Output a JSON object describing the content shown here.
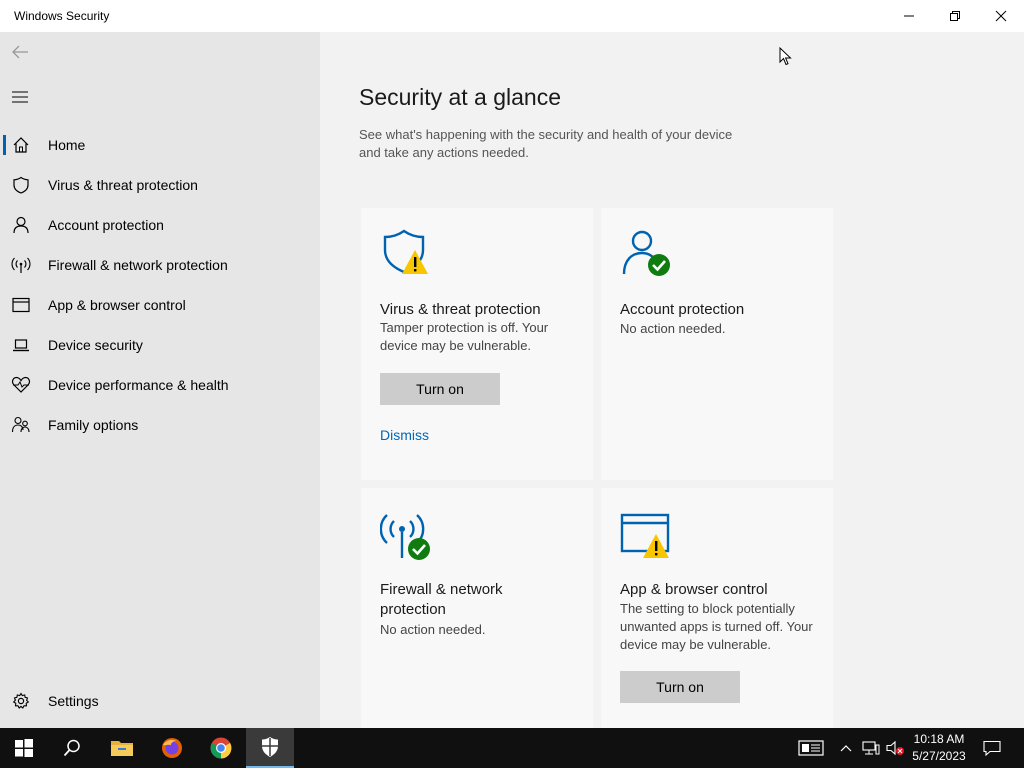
{
  "window": {
    "title": "Windows Security"
  },
  "sidebar": {
    "items": [
      {
        "label": "Home"
      },
      {
        "label": "Virus & threat protection"
      },
      {
        "label": "Account protection"
      },
      {
        "label": "Firewall & network protection"
      },
      {
        "label": "App & browser control"
      },
      {
        "label": "Device security"
      },
      {
        "label": "Device performance & health"
      },
      {
        "label": "Family options"
      }
    ],
    "settings_label": "Settings"
  },
  "main": {
    "title": "Security at a glance",
    "description": "See what's happening with the security and health of your device and take any actions needed.",
    "cards": [
      {
        "title": "Virus & threat protection",
        "description": "Tamper protection is off. Your device may be vulnerable.",
        "button": "Turn on",
        "link": "Dismiss",
        "status": "warning"
      },
      {
        "title": "Account protection",
        "description": "No action needed.",
        "status": "ok"
      },
      {
        "title": "Firewall & network protection",
        "description": "No action needed.",
        "status": "ok"
      },
      {
        "title": "App & browser control",
        "description": "The setting to block potentially unwanted apps is turned off. Your device may be vulnerable.",
        "button": "Turn on",
        "status": "warning"
      }
    ]
  },
  "taskbar": {
    "apps": [
      "start-icon",
      "search-icon",
      "file-explorer-icon",
      "firefox-icon",
      "chrome-icon",
      "windows-security-icon"
    ],
    "time": "10:18 AM",
    "date": "5/27/2023"
  },
  "colors": {
    "accent": "#0063b1",
    "warning": "#f7c600",
    "ok": "#107c10",
    "link": "#0067b8"
  }
}
